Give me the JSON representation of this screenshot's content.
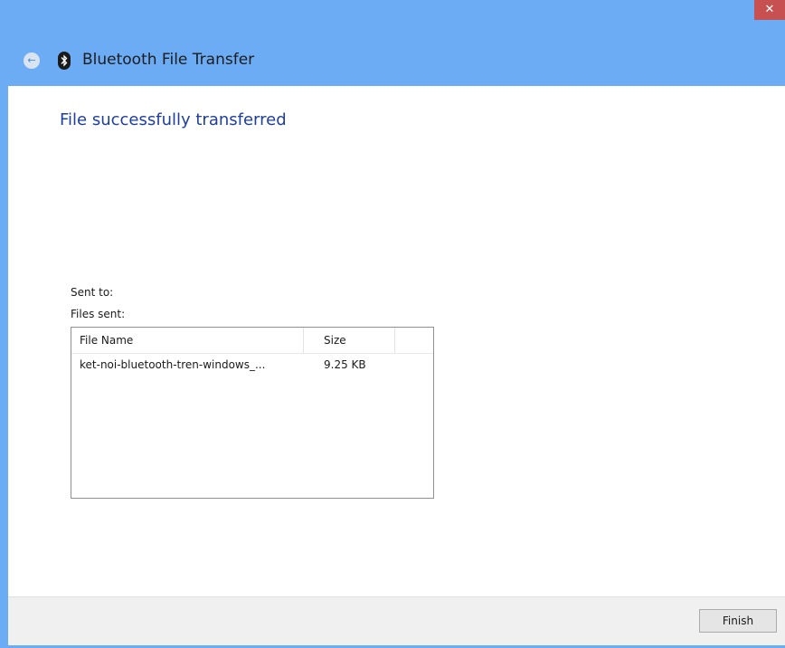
{
  "window": {
    "title": "Bluetooth File Transfer",
    "close_glyph": "✕",
    "back_glyph": "←"
  },
  "main": {
    "heading": "File successfully transferred",
    "sent_to_label": "Sent to:",
    "files_sent_label": "Files sent:"
  },
  "file_list": {
    "columns": [
      "File Name",
      "Size"
    ],
    "rows": [
      {
        "name": "ket-noi-bluetooth-tren-windows_...",
        "size": "9.25 KB"
      }
    ]
  },
  "footer": {
    "finish_label": "Finish"
  },
  "icons": {
    "back": "back-arrow-icon",
    "bluetooth": "bluetooth-icon",
    "close": "close-icon"
  },
  "colors": {
    "frame": "#6cacf5",
    "close": "#c75050",
    "heading": "#1e3f9c",
    "footer": "#f0f0f0"
  }
}
